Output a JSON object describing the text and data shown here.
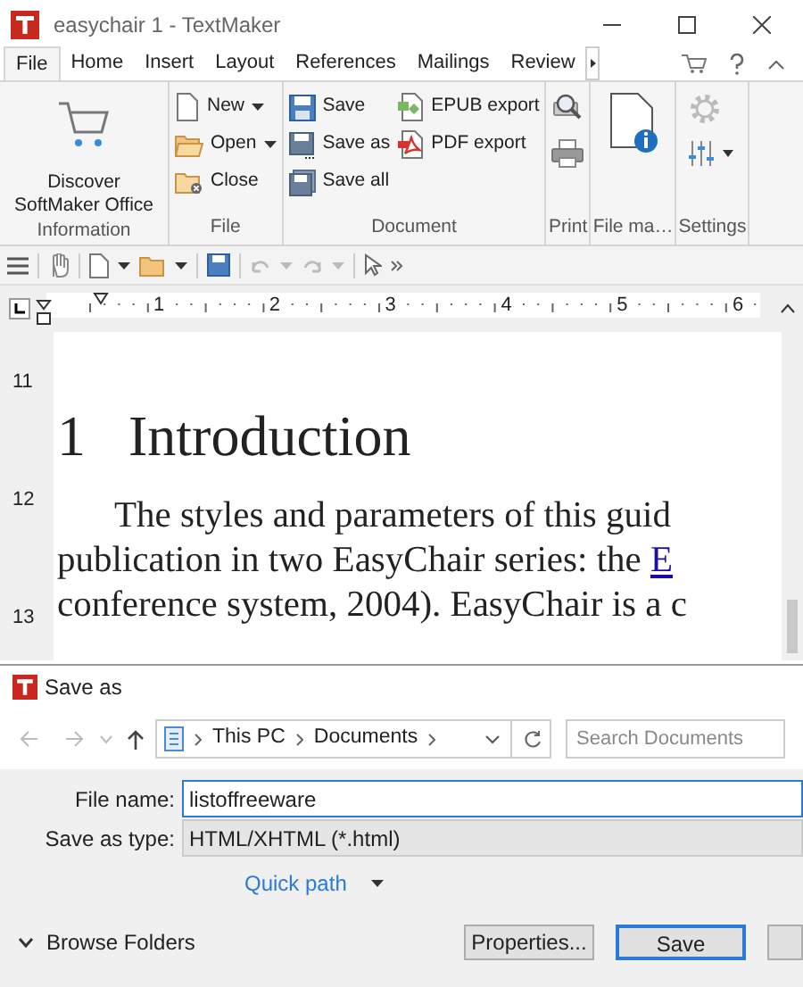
{
  "window": {
    "title": "easychair 1 - TextMaker"
  },
  "tabs": [
    {
      "label": "File",
      "selected": true
    },
    {
      "label": "Home",
      "selected": false
    },
    {
      "label": "Insert",
      "selected": false
    },
    {
      "label": "Layout",
      "selected": false
    },
    {
      "label": "References",
      "selected": false
    },
    {
      "label": "Mailings",
      "selected": false
    },
    {
      "label": "Review",
      "selected": false
    }
  ],
  "ribbon": {
    "groups": [
      {
        "label": "Information",
        "items": [
          {
            "kind": "big",
            "label": "Discover SoftMaker Office"
          }
        ]
      },
      {
        "label": "File",
        "items": [
          {
            "kind": "small",
            "label": "New",
            "dropdown": true
          },
          {
            "kind": "small",
            "label": "Open",
            "dropdown": true
          },
          {
            "kind": "small",
            "label": "Close",
            "dropdown": false
          }
        ]
      },
      {
        "label": "Document",
        "items": [
          {
            "kind": "small",
            "label": "Save",
            "dropdown": false
          },
          {
            "kind": "small",
            "label": "Save as",
            "dropdown": false
          },
          {
            "kind": "small",
            "label": "Save all",
            "dropdown": false
          },
          {
            "kind": "small",
            "label": "EPUB export",
            "dropdown": false
          },
          {
            "kind": "small",
            "label": "PDF export",
            "dropdown": false
          }
        ]
      },
      {
        "label": "Print",
        "items": [
          {
            "kind": "icon"
          },
          {
            "kind": "icon"
          }
        ]
      },
      {
        "label": "File ma…",
        "items": [
          {
            "kind": "bigicon"
          }
        ]
      },
      {
        "label": "Settings",
        "items": [
          {
            "kind": "icon"
          },
          {
            "kind": "icon"
          }
        ]
      }
    ]
  },
  "ruler": {
    "numbers": [
      "1",
      "2",
      "3",
      "4",
      "5",
      "6"
    ]
  },
  "vertical_ruler": {
    "numbers": [
      "11",
      "12",
      "13"
    ]
  },
  "document": {
    "heading_number": "1",
    "heading": "Introduction",
    "lines": [
      "The styles and parameters of this guid",
      "publication in two EasyChair series: the **E**",
      "conference system, 2004). EasyChair is a c"
    ]
  },
  "dialog": {
    "title": "Save as",
    "path": [
      "This PC",
      "Documents"
    ],
    "search_placeholder": "Search Documents",
    "file_name_label": "File name:",
    "file_name": "listoffreeware",
    "type_label": "Save as type:",
    "type": "HTML/XHTML (*.html)",
    "quick_path": "Quick path",
    "browse_folders": "Browse Folders",
    "buttons": [
      "Properties...",
      "Save"
    ]
  }
}
